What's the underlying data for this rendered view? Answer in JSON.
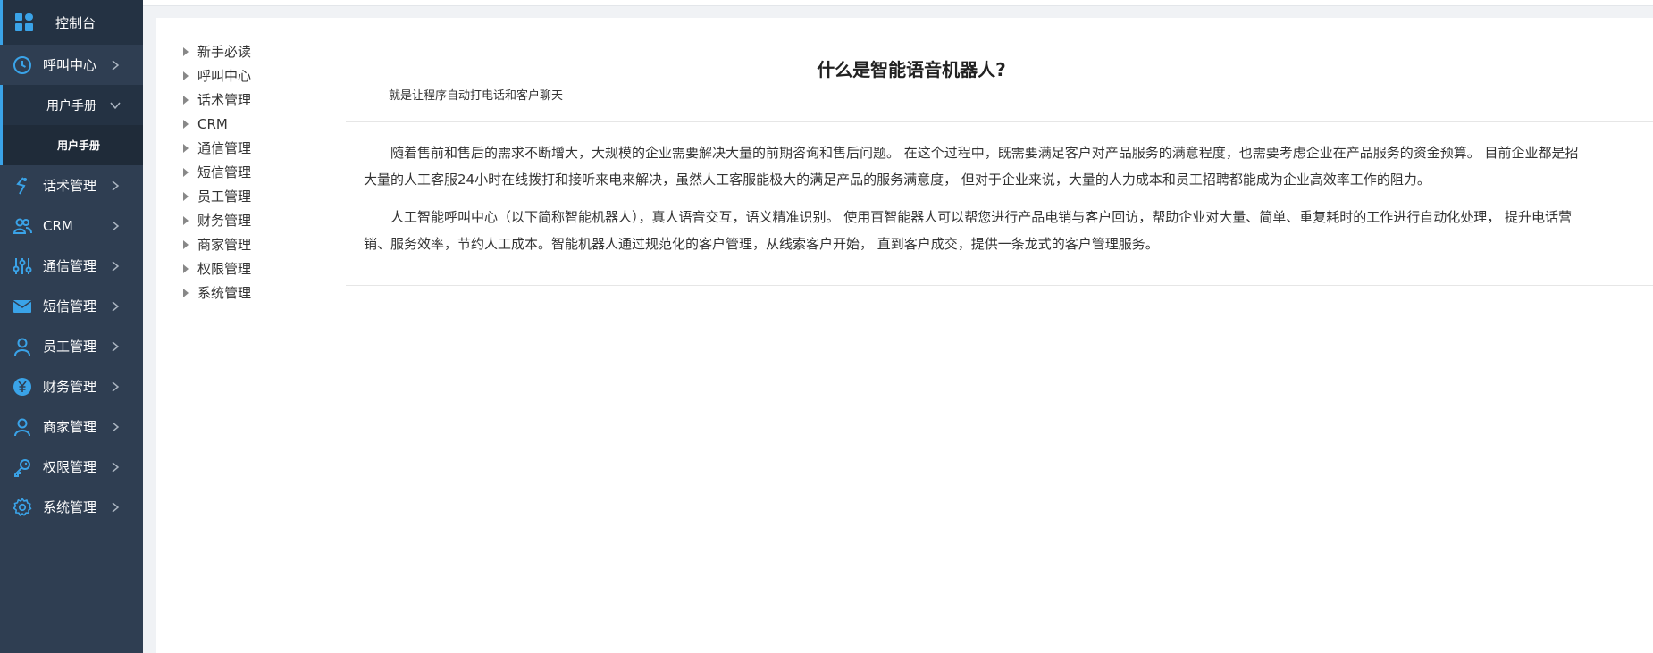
{
  "sidebar": {
    "top": {
      "label": "控制台",
      "icon": "dashboard-icon"
    },
    "items": [
      {
        "label": "呼叫中心",
        "icon": "clock-icon"
      },
      {
        "label": "话术管理",
        "icon": "script-icon"
      },
      {
        "label": "CRM",
        "icon": "users-icon"
      },
      {
        "label": "通信管理",
        "icon": "sliders-icon"
      },
      {
        "label": "短信管理",
        "icon": "mail-icon"
      },
      {
        "label": "员工管理",
        "icon": "user-icon"
      },
      {
        "label": "财务管理",
        "icon": "yuan-icon"
      },
      {
        "label": "商家管理",
        "icon": "user-icon"
      },
      {
        "label": "权限管理",
        "icon": "key-icon"
      },
      {
        "label": "系统管理",
        "icon": "gear-icon"
      }
    ],
    "submenu": {
      "label": "用户手册"
    },
    "subsubmenu": {
      "label": "用户手册"
    }
  },
  "tree": {
    "items": [
      "新手必读",
      "呼叫中心",
      "话术管理",
      "CRM",
      "通信管理",
      "短信管理",
      "员工管理",
      "财务管理",
      "商家管理",
      "权限管理",
      "系统管理"
    ]
  },
  "article": {
    "title": "什么是智能语音机器人?",
    "subtitle": "就是让程序自动打电话和客户聊天",
    "p1_line1": "随着售前和售后的需求不断增大，大规模的企业需要解决大量的前期咨询和售后问题。 在这个过程中，既需要满足客户对产品服务的满意程度，也需要考虑企业在产品服务的资金预算。 目前企业都是招",
    "p1_line2": "大量的人工客服24小时在线拨打和接听来电来解决，虽然人工客服能极大的满足产品的服务满意度， 但对于企业来说，大量的人力成本和员工招聘都能成为企业高效率工作的阻力。",
    "p2_line1": "人工智能呼叫中心（以下简称智能机器人），真人语音交互，语义精准识别。 使用百智能器人可以帮您进行产品电销与客户回访，帮助企业对大量、简单、重复耗时的工作进行自动化处理， 提升电话营",
    "p2_line2": "销、服务效率，节约人工成本。智能机器人通过规范化的客户管理，从线索客户开始， 直到客户成交，提供一条龙式的客户管理服务。"
  },
  "colors": {
    "sidebar_bg": "#2f3e52",
    "accent": "#3aa3e8"
  }
}
